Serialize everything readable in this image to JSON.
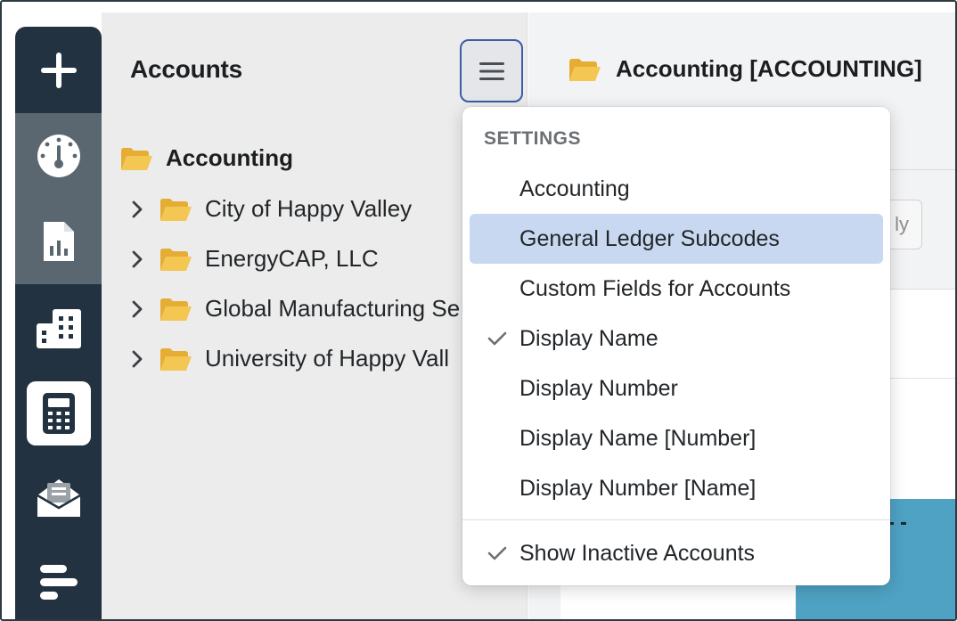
{
  "sidebar": {
    "items": [
      {
        "icon": "plus-icon"
      },
      {
        "icon": "dashboard-gauge-icon"
      },
      {
        "icon": "report-chart-icon"
      },
      {
        "icon": "buildings-icon"
      },
      {
        "icon": "calculator-icon"
      },
      {
        "icon": "mail-clipboard-icon"
      },
      {
        "icon": "gantt-icon"
      }
    ]
  },
  "accounts_panel": {
    "title": "Accounts",
    "menu_icon": "hamburger-icon",
    "tree": {
      "root": "Accounting",
      "children": [
        "City of Happy Valley",
        "EnergyCAP, LLC",
        "Global Manufacturing Se",
        "University of Happy Vall"
      ]
    }
  },
  "content": {
    "title": "Accounting [ACCOUNTING]",
    "filter_button_partial": "ly"
  },
  "settings_menu": {
    "header": "SETTINGS",
    "items": [
      {
        "label": "Accounting",
        "checked": false,
        "highlighted": false
      },
      {
        "label": "General Ledger Subcodes",
        "checked": false,
        "highlighted": true
      },
      {
        "label": "Custom Fields for Accounts",
        "checked": false,
        "highlighted": false
      },
      {
        "label": "Display Name",
        "checked": true,
        "highlighted": false
      },
      {
        "label": "Display Number",
        "checked": false,
        "highlighted": false
      },
      {
        "label": "Display Name [Number]",
        "checked": false,
        "highlighted": false
      },
      {
        "label": "Display Number [Name]",
        "checked": false,
        "highlighted": false
      }
    ],
    "footer_item": {
      "label": "Show Inactive Accounts",
      "checked": true
    }
  },
  "colors": {
    "rail": "#223240",
    "rail_active": "#5a6771",
    "highlight": "#c8d8f0",
    "folder": "#f2c24f",
    "menu_button_border": "#3c5ba8"
  }
}
